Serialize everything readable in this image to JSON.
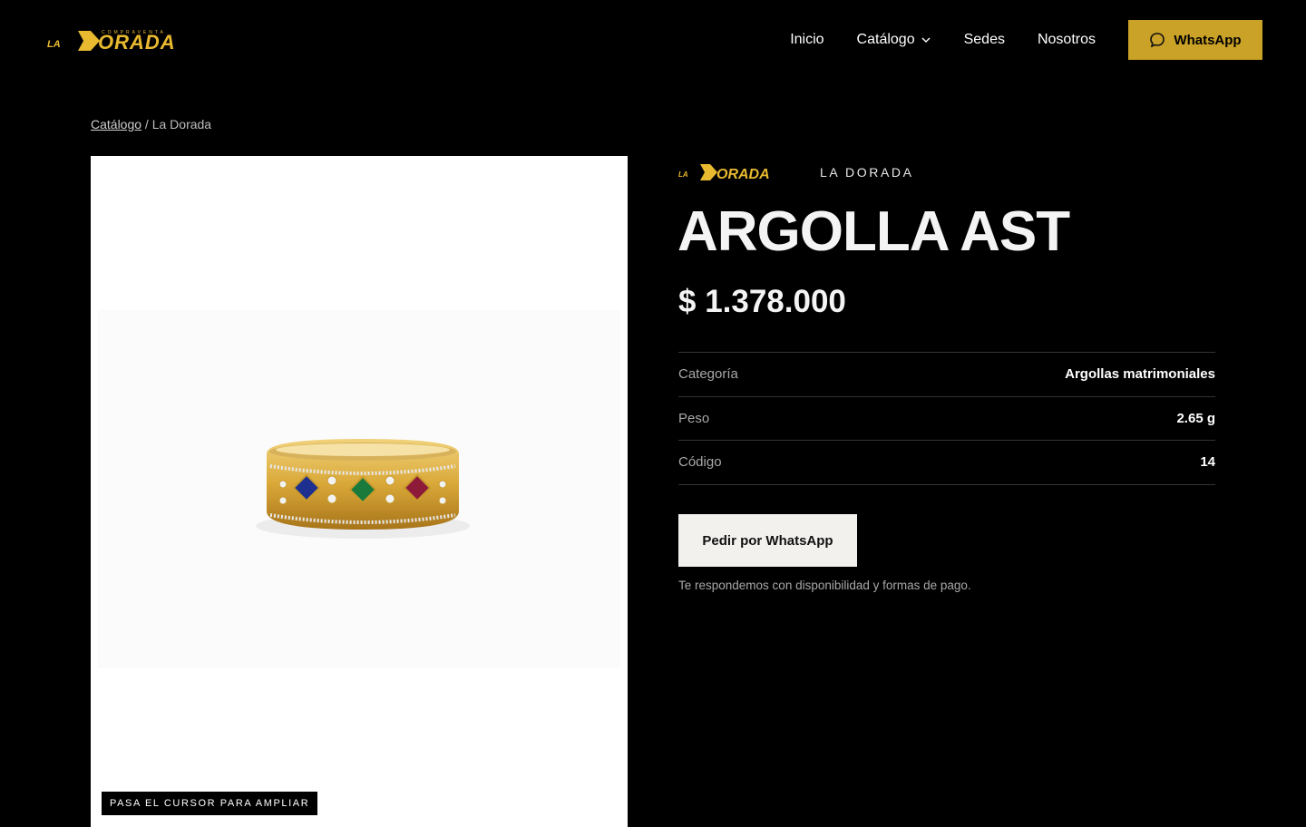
{
  "header": {
    "logo_alt": "La Dorada",
    "nav": [
      {
        "label": "Inicio"
      },
      {
        "label": "Catálogo"
      },
      {
        "label": "Sedes"
      },
      {
        "label": "Nosotros"
      }
    ],
    "whatsapp_label": "WhatsApp",
    "accent_color": "#c9a227"
  },
  "breadcrumb": {
    "link": "Catálogo",
    "separator": " / ",
    "current": "La Dorada"
  },
  "product": {
    "brand": "LA DORADA",
    "title": "ARGOLLA AST",
    "price": "$ 1.378.000",
    "zoom_hint": "PASA EL CURSOR PARA AMPLIAR",
    "specs": [
      {
        "label": "Categoría",
        "value": "Argollas matrimoniales"
      },
      {
        "label": "Peso",
        "value": "2.65 g"
      },
      {
        "label": "Código",
        "value": "14"
      }
    ],
    "order_label": "Pedir por WhatsApp",
    "note": "Te respondemos con disponibilidad y formas de pago."
  }
}
